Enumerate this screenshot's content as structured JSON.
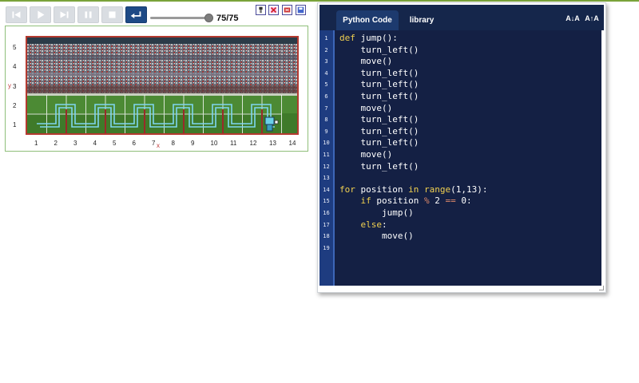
{
  "toolbar": {
    "buttons": [
      {
        "name": "step-back",
        "icon": "skip-back-icon"
      },
      {
        "name": "play",
        "icon": "play-icon"
      },
      {
        "name": "step-forward",
        "icon": "skip-forward-icon"
      },
      {
        "name": "pause",
        "icon": "pause-icon"
      },
      {
        "name": "stop",
        "icon": "stop-icon"
      },
      {
        "name": "reset",
        "icon": "return-icon"
      }
    ],
    "progress": 1.0,
    "counter": "75/75",
    "tiny_icons": [
      "robot-icon",
      "delete-icon",
      "clear-icon",
      "save-icon"
    ]
  },
  "world": {
    "x_ticks": [
      "1",
      "2",
      "3",
      "4",
      "5",
      "6",
      "7",
      "8",
      "9",
      "10",
      "11",
      "12",
      "13",
      "14"
    ],
    "y_ticks": [
      "5",
      "4",
      "3",
      "2",
      "1"
    ],
    "x_axis_name": "x",
    "y_axis_name": "y"
  },
  "editor": {
    "tabs": [
      "Python Code",
      "library"
    ],
    "font_smaller": "A↓A",
    "font_larger": "A↑A",
    "line_numbers": [
      "1",
      "2",
      "3",
      "4",
      "5",
      "6",
      "7",
      "8",
      "9",
      "10",
      "11",
      "12",
      "13",
      "14",
      "15",
      "16",
      "17",
      "18",
      "19"
    ],
    "lines": [
      "def jump():",
      "    turn_left()",
      "    move()",
      "    turn_left()",
      "    turn_left()",
      "    turn_left()",
      "    move()",
      "    turn_left()",
      "    turn_left()",
      "    turn_left()",
      "    move()",
      "    turn_left()",
      "",
      "for position in range(1,13):",
      "    if position % 2 == 0:",
      "        jump()",
      "    else:",
      "        move()",
      ""
    ]
  },
  "colors": {
    "accent": "#1e4a86",
    "editor_bg": "#142044",
    "keyword": "#f0d050",
    "border_red": "#b43a30"
  }
}
